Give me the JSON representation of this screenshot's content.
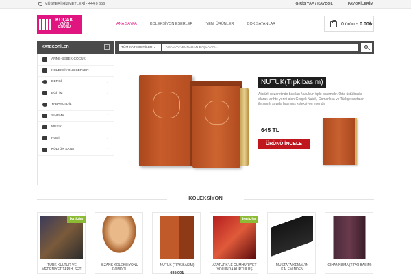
{
  "topbar": {
    "service": "MÜŞTERİ HİZMETLERİ - 444 0 656",
    "login": "GİRİŞ YAP / KAYDOL",
    "favorites": "FAVORİLERİM"
  },
  "logo": {
    "line1": "KOÇAK",
    "line2": "YAYIN",
    "line3": "GRUBU"
  },
  "nav": [
    "ANA SAYFA",
    "KOLEKSİYON ESERLER",
    "YENİ ÜRÜNLER",
    "ÇOK SATANLAR"
  ],
  "cart": {
    "count": "0 ürün -",
    "total": "0.00₺"
  },
  "categories_title": "KATEGORİLER",
  "search": {
    "category": "TÜM KATEGORİLER",
    "placeholder": "ARAMAYA BURADAN BAŞLAYIN..."
  },
  "categories": [
    {
      "label": "ANNE-BEBEK-ÇOCUK",
      "icon": "baby-icon",
      "arrow": false
    },
    {
      "label": "KOLEKSİYON ESERLER",
      "icon": "bookmark-icon",
      "arrow": false
    },
    {
      "label": "DERGİ",
      "icon": "circle-icon",
      "arrow": true
    },
    {
      "label": "EĞİTİM",
      "icon": "pencil-icon",
      "arrow": true
    },
    {
      "label": "YABANCI DİL",
      "icon": "chat-icon",
      "arrow": false
    },
    {
      "label": "SİNEMA",
      "icon": "camera-icon",
      "arrow": true
    },
    {
      "label": "MÜZİK",
      "icon": "music-icon",
      "arrow": false
    },
    {
      "label": "HOBİ",
      "icon": "cutlery-icon",
      "arrow": true
    },
    {
      "label": "KÜLTÜR SANAT",
      "icon": "puzzle-icon",
      "arrow": true
    }
  ],
  "hero": {
    "title": "NUTUK(Tıpkıbasım)",
    "description": "Atatürk nezaretinde basılan Nutuk'un tıpkı basımıdır. Orta üstü baskı olarak tarihte yerini alan Gerçek Nutuk, Osmanlıca ve Türkçe sayfaları ile sınırlı sayıda basılmış koleksiyon eseridir",
    "price": "645 TL",
    "button": "ÜRÜNÜ İNCELE"
  },
  "section_title": "KOLEKSİYON",
  "products": [
    {
      "name": "TÜRK KÜLTÜR VE MEDENİYET TARİHİ SETİ",
      "price": "",
      "badge": "İNDİRİM"
    },
    {
      "name": "BİZANS KOLEKSİYONU GONDOL",
      "price": "",
      "badge": ""
    },
    {
      "name": "NUTUK (TIPKIBASIM)",
      "price": "695.00₺",
      "badge": ""
    },
    {
      "name": "ATATÜRK'LE CUMHURİYET YOLUNDA KURTULUŞ",
      "price": "",
      "badge": "İNDİRİM"
    },
    {
      "name": "MUSTAFA KEMAL'İN KALEMİNDEN",
      "price": "",
      "badge": ""
    },
    {
      "name": "CİHANNÜMA (TIPKI BASIM)",
      "price": "",
      "badge": ""
    }
  ]
}
